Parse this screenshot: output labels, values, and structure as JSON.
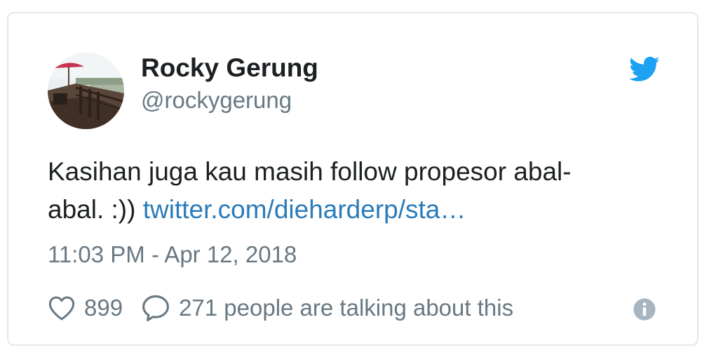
{
  "author": {
    "name": "Rocky Gerung",
    "handle": "@rockygerung",
    "avatar_icon": "avatar-photo"
  },
  "tweet": {
    "text_line1": "Kasihan juga kau masih follow propesor abal-",
    "text_line2_prefix": "abal. :))",
    "link_text": "twitter.com/dieharderp/sta…",
    "timestamp": "11:03 PM - Apr 12, 2018"
  },
  "actions": {
    "like_icon": "heart-icon",
    "like_count": "899",
    "reply_icon": "speech-bubble-icon",
    "reply_text": "271 people are talking about this",
    "info_icon": "info-icon"
  },
  "brand": {
    "logo_icon": "twitter-bird-icon",
    "accent_color": "#1da1f2",
    "link_color": "#2b7bb9",
    "muted_text_color": "#697882",
    "text_color": "#1c2022",
    "border_color": "#e1e8ed"
  }
}
